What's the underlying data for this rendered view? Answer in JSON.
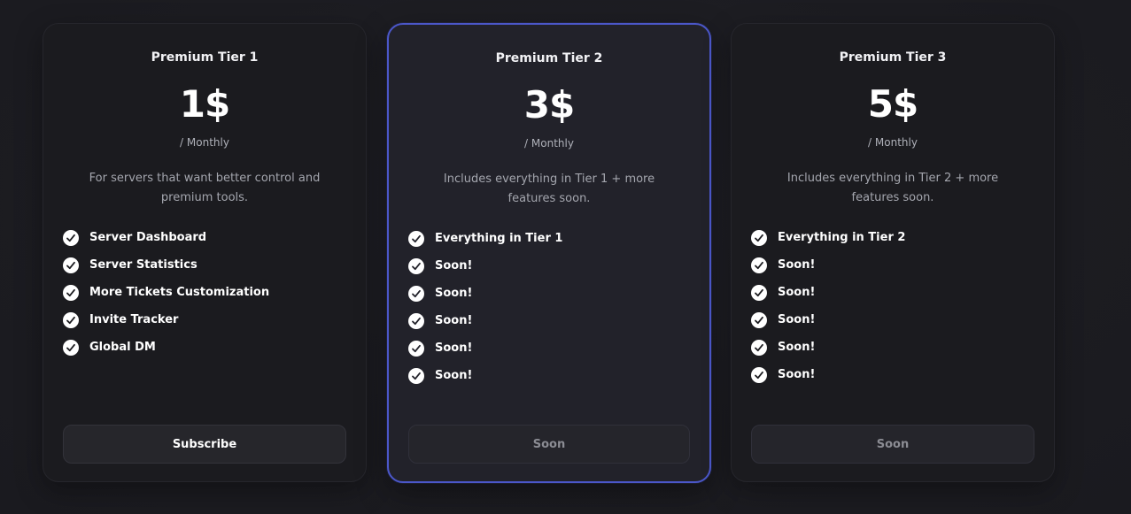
{
  "plans": [
    {
      "name": "Premium Tier 1",
      "price": "1$",
      "period": "/ Monthly",
      "description": "For servers that want better control and premium tools.",
      "features": [
        "Server Dashboard",
        "Server Statistics",
        "More Tickets Customization",
        "Invite Tracker",
        "Global DM"
      ],
      "button": "Subscribe",
      "highlighted": false
    },
    {
      "name": "Premium Tier 2",
      "price": "3$",
      "period": "/ Monthly",
      "description": "Includes everything in Tier 1 + more features soon.",
      "features": [
        "Everything in Tier 1",
        "Soon!",
        "Soon!",
        "Soon!",
        "Soon!",
        "Soon!"
      ],
      "button": "Soon",
      "highlighted": true
    },
    {
      "name": "Premium Tier 3",
      "price": "5$",
      "period": "/ Monthly",
      "description": "Includes everything in Tier 2 + more features soon.",
      "features": [
        "Everything in Tier 2",
        "Soon!",
        "Soon!",
        "Soon!",
        "Soon!",
        "Soon!"
      ],
      "button": "Soon",
      "highlighted": false
    }
  ],
  "colors": {
    "background": "#1d1d22",
    "card": "#1b1b1f",
    "highlight_border": "#4b57c9",
    "text": "#ffffff",
    "muted": "#a4a6ae"
  },
  "icons": {
    "feature_bullet": "check-circle-icon"
  }
}
